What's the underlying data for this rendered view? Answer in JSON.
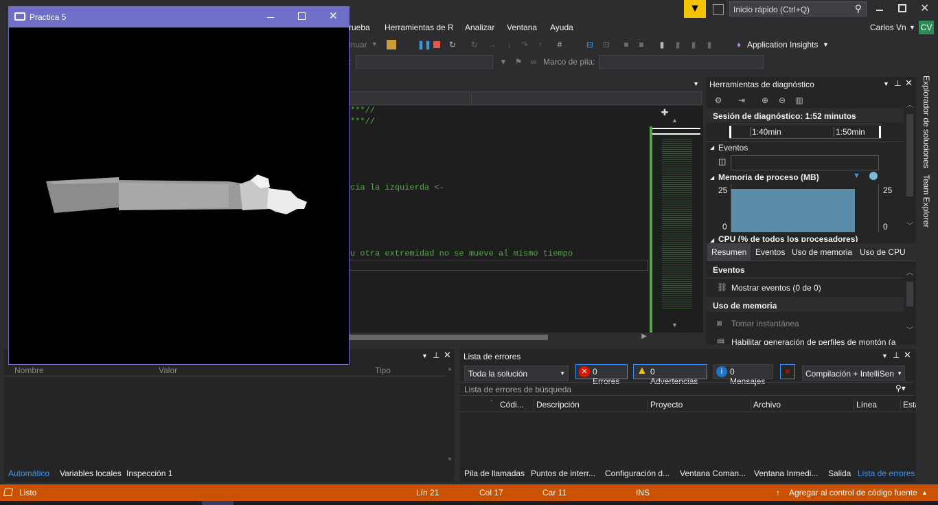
{
  "search": {
    "placeholder": "Inicio rápido (Ctrl+Q)"
  },
  "user": {
    "name": "Carlos Vn",
    "initials": "CV"
  },
  "menu": [
    "rueba",
    "Herramientas de R",
    "Analizar",
    "Ventana",
    "Ayuda"
  ],
  "toolbar": {
    "continue_label": "inuar",
    "app_insights": "Application Insights",
    "stack_frame_label": "Marco de pila:"
  },
  "editor": {
    "lines": [
      "***//",
      "***//",
      "cia la izquierda <-",
      "u otra extremidad no se mueve al mismo tiempo"
    ]
  },
  "diagnostics": {
    "title": "Herramientas de diagnóstico",
    "session": "Sesión de diagnóstico: 1:52 minutos",
    "ticks": [
      "1:40min",
      "1:50min"
    ],
    "events_label": "Eventos",
    "memory_label": "Memoria de proceso (MB)",
    "mem_max_left": "25",
    "mem_min_left": "0",
    "mem_max_right": "25",
    "mem_min_right": "0",
    "cpu_label": "CPU (% de todos los procesadores)",
    "tabs": [
      "Resumen",
      "Eventos",
      "Uso de memoria",
      "Uso de CPU"
    ],
    "summary_events_header": "Eventos",
    "show_events": "Mostrar eventos (0 de 0)",
    "memory_usage_header": "Uso de memoria",
    "take_snapshot": "Tomar instantánea",
    "heap_profiling": "Habilitar generación de perfiles de montón (a"
  },
  "autos": {
    "columns": [
      "Nombre",
      "Valor",
      "Tipo"
    ],
    "tabs": [
      "Automático",
      "Variables locales",
      "Inspección 1"
    ]
  },
  "errors": {
    "title": "Lista de errores",
    "scope": "Toda la solución",
    "errors_btn": "0 Errores",
    "warnings_btn": "0 Advertencias",
    "messages_btn": "0 Mensajes",
    "build_filter": "Compilación + IntelliSen",
    "search_placeholder": "Lista de errores de búsqueda",
    "columns": [
      "Códi...",
      "Descripción",
      "Proyecto",
      "Archivo",
      "Línea",
      "Esta"
    ],
    "bottom_tabs": [
      "Pila de llamadas",
      "Puntos de interr...",
      "Configuración d...",
      "Ventana Coman...",
      "Ventana Inmedi...",
      "Salida",
      "Lista de errores"
    ]
  },
  "side_tabs": [
    "Explorador de soluciones",
    "Team Explorer"
  ],
  "status": {
    "ready": "Listo",
    "line": "Lín 21",
    "col": "Col 17",
    "car": "Car 11",
    "ins": "INS",
    "source_control": "Agregar al control de código fuente"
  },
  "floating": {
    "title": "Practica 5"
  },
  "colors": {
    "accent": "#6f6fc7",
    "status": "#ca5100",
    "link": "#3794ff",
    "chart_fill": "#5b8ca8"
  }
}
